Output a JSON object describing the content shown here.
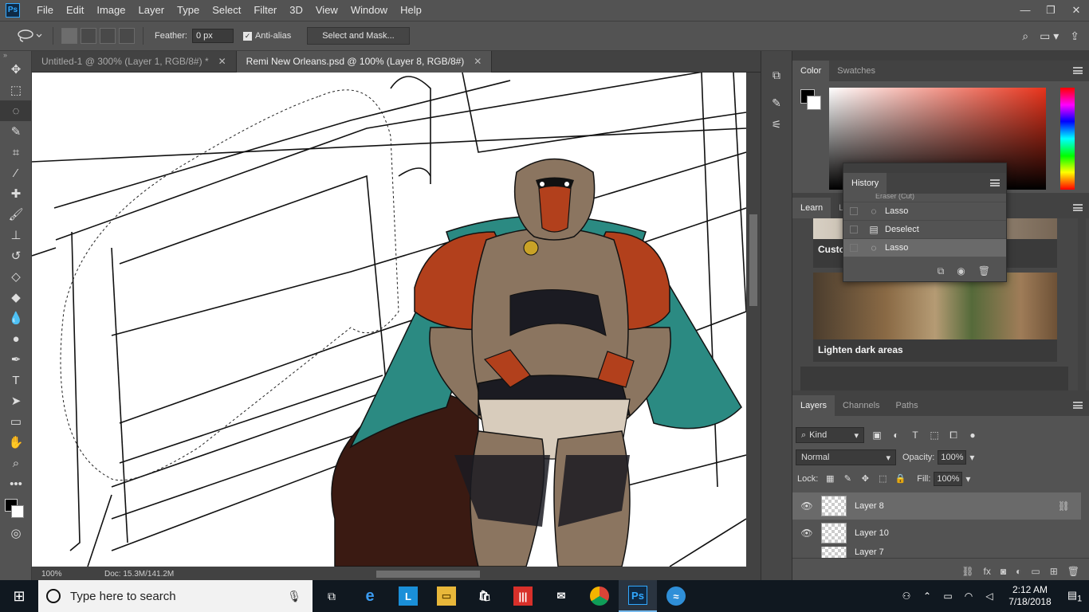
{
  "app": {
    "logo": "Ps"
  },
  "menu": [
    "File",
    "Edit",
    "Image",
    "Layer",
    "Type",
    "Select",
    "Filter",
    "3D",
    "View",
    "Window",
    "Help"
  ],
  "window_controls": {
    "minimize": "—",
    "restore": "❐",
    "close": "✕"
  },
  "options": {
    "feather_label": "Feather:",
    "feather_value": "0 px",
    "antialias_label": "Anti-alias",
    "select_mask_label": "Select and Mask..."
  },
  "tabs": [
    {
      "label": "Untitled-1 @ 300% (Layer 1, RGB/8#) *",
      "close": "✕",
      "active": false
    },
    {
      "label": "Remi New Orleans.psd @ 100% (Layer 8, RGB/8#)",
      "close": "✕",
      "active": true
    }
  ],
  "status": {
    "zoom": "100%",
    "doc": "Doc: 15.3M/141.2M"
  },
  "color_panel": {
    "tabs": [
      "Color",
      "Swatches"
    ],
    "foreground": "#000000",
    "background": "#ffffff"
  },
  "learn_panel": {
    "tabs": [
      "Learn",
      "Li"
    ],
    "card1_title": "Custo",
    "card2_title": "Lighten dark areas"
  },
  "history_panel": {
    "title": "History",
    "items": [
      "Eraser (Cut)",
      "Lasso",
      "Deselect",
      "Lasso"
    ],
    "selected_index": 3
  },
  "layers_panel": {
    "tabs": [
      "Layers",
      "Channels",
      "Paths"
    ],
    "kind": "Kind",
    "blend_mode": "Normal",
    "opacity_label": "Opacity:",
    "opacity": "100%",
    "lock_label": "Lock:",
    "fill_label": "Fill:",
    "fill": "100%",
    "layers": [
      {
        "name": "Layer 8",
        "selected": true
      },
      {
        "name": "Layer 10",
        "selected": false
      },
      {
        "name": "Layer 7",
        "selected": false
      }
    ]
  },
  "taskbar": {
    "search_placeholder": "Type here to search",
    "time": "2:12 AM",
    "date": "7/18/2018",
    "notification_count": "1"
  },
  "colors": {
    "fur": "#8b7560",
    "red": "#b2401c",
    "teal": "#2b8a82",
    "tail": "#3a1a12",
    "dark": "#1b1b22"
  }
}
